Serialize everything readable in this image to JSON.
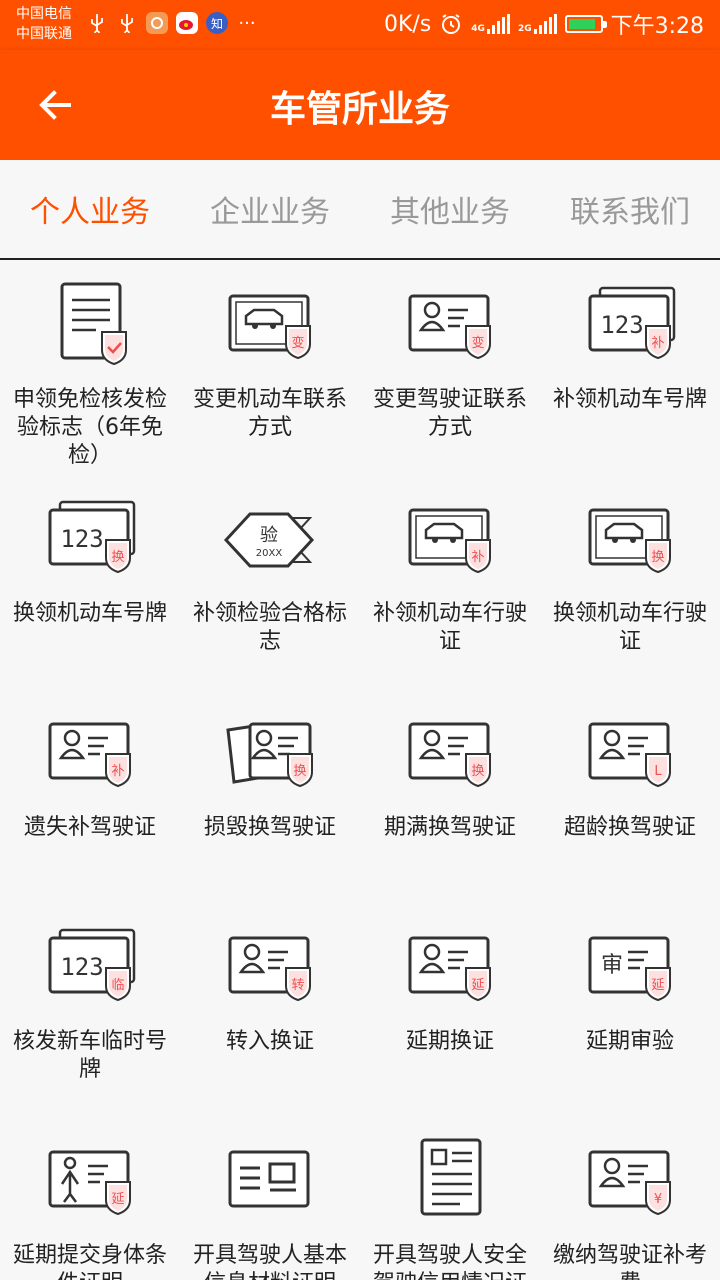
{
  "status_bar": {
    "carrier1": "中国电信",
    "carrier2": "中国联通",
    "speed": "0K/s",
    "net1": "4G",
    "net2": "2G",
    "time": "下午3:28",
    "app_zhihu": "知",
    "more": "···",
    "icons": [
      "usb-icon",
      "usb-icon",
      "photo-app-icon",
      "weibo-icon",
      "zhihu-icon",
      "more-icon",
      "alarm-icon",
      "signal-icon",
      "battery-icon"
    ]
  },
  "header": {
    "title": "车管所业务"
  },
  "tabs": [
    {
      "label": "个人业务",
      "active": true
    },
    {
      "label": "企业业务",
      "active": false
    },
    {
      "label": "其他业务",
      "active": false
    },
    {
      "label": "联系我们",
      "active": false
    }
  ],
  "colors": {
    "brand": "#ff5000",
    "badge": "#ee5050",
    "icon": "#333333"
  },
  "services": [
    {
      "label": "申领免检核发检验标志（6年免检）",
      "icon": "document-check-icon",
      "badge": ""
    },
    {
      "label": "变更机动车联系方式",
      "icon": "vehicle-card-icon",
      "badge": "变"
    },
    {
      "label": "变更驾驶证联系方式",
      "icon": "id-card-icon",
      "badge": "变"
    },
    {
      "label": "补领机动车号牌",
      "icon": "license-plate-icon",
      "badge": "补"
    },
    {
      "label": "换领机动车号牌",
      "icon": "license-plate-icon",
      "badge": "换"
    },
    {
      "label": "补领检验合格标志",
      "icon": "inspection-sticker-icon",
      "badge": "验",
      "sub": "20XX"
    },
    {
      "label": "补领机动车行驶证",
      "icon": "vehicle-card-icon",
      "badge": "补"
    },
    {
      "label": "换领机动车行驶证",
      "icon": "vehicle-card-icon",
      "badge": "换"
    },
    {
      "label": "遗失补驾驶证",
      "icon": "id-card-icon",
      "badge": "补"
    },
    {
      "label": "损毁换驾驶证",
      "icon": "damaged-card-icon",
      "badge": "换"
    },
    {
      "label": "期满换驾驶证",
      "icon": "id-card-icon",
      "badge": "换"
    },
    {
      "label": "超龄换驾驶证",
      "icon": "id-card-icon",
      "badge": "L"
    },
    {
      "label": "核发新车临时号牌",
      "icon": "license-plate-icon",
      "badge": "临"
    },
    {
      "label": "转入换证",
      "icon": "id-card-icon",
      "badge": "转"
    },
    {
      "label": "延期换证",
      "icon": "id-card-icon",
      "badge": "延"
    },
    {
      "label": "延期审验",
      "icon": "review-card-icon",
      "badge": "延",
      "sub": "审"
    },
    {
      "label": "延期提交身体条件证明",
      "icon": "body-card-icon",
      "badge": "延"
    },
    {
      "label": "开具驾驶人基本信息材料证明",
      "icon": "info-card-icon",
      "badge": ""
    },
    {
      "label": "开具驾驶人安全驾驶信用情况证明",
      "icon": "report-doc-icon",
      "badge": ""
    },
    {
      "label": "缴纳驾驶证补考费",
      "icon": "id-card-icon",
      "badge": "¥"
    }
  ]
}
